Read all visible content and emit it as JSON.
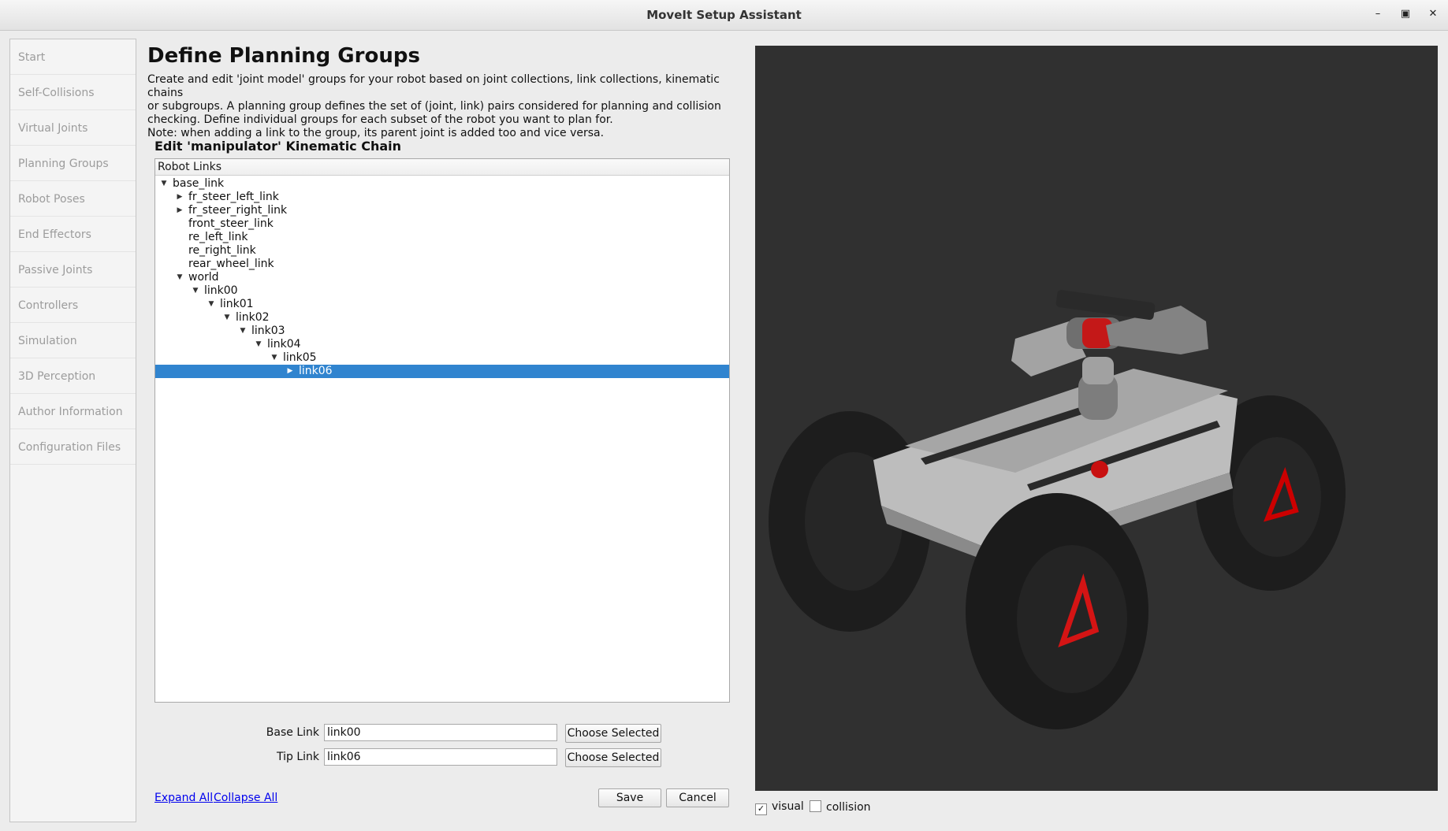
{
  "window": {
    "title": "MoveIt Setup Assistant"
  },
  "sidebar": {
    "items": [
      {
        "label": "Start"
      },
      {
        "label": "Self-Collisions"
      },
      {
        "label": "Virtual Joints"
      },
      {
        "label": "Planning Groups"
      },
      {
        "label": "Robot Poses"
      },
      {
        "label": "End Effectors"
      },
      {
        "label": "Passive Joints"
      },
      {
        "label": "Controllers"
      },
      {
        "label": "Simulation"
      },
      {
        "label": "3D Perception"
      },
      {
        "label": "Author Information"
      },
      {
        "label": "Configuration Files"
      }
    ]
  },
  "main": {
    "heading": "Define Planning Groups",
    "description_lines": [
      "Create and edit 'joint model' groups for your robot based on joint collections, link collections, kinematic chains",
      "or subgroups. A planning group defines the set of (joint, link) pairs considered for planning and collision",
      "checking. Define individual groups for each subset of the robot you want to plan for.",
      "Note: when adding a link to the group, its parent joint is added too and vice versa."
    ],
    "subheading": "Edit 'manipulator' Kinematic Chain",
    "tree": {
      "header": "Robot Links",
      "rows": [
        {
          "label": "base_link",
          "depth": 0,
          "expander": "expanded",
          "selected": false
        },
        {
          "label": "fr_steer_left_link",
          "depth": 1,
          "expander": "collapsed",
          "selected": false
        },
        {
          "label": "fr_steer_right_link",
          "depth": 1,
          "expander": "collapsed",
          "selected": false
        },
        {
          "label": "front_steer_link",
          "depth": 1,
          "expander": "none",
          "selected": false
        },
        {
          "label": "re_left_link",
          "depth": 1,
          "expander": "none",
          "selected": false
        },
        {
          "label": "re_right_link",
          "depth": 1,
          "expander": "none",
          "selected": false
        },
        {
          "label": "rear_wheel_link",
          "depth": 1,
          "expander": "none",
          "selected": false
        },
        {
          "label": "world",
          "depth": 1,
          "expander": "expanded",
          "selected": false
        },
        {
          "label": "link00",
          "depth": 2,
          "expander": "expanded",
          "selected": false
        },
        {
          "label": "link01",
          "depth": 3,
          "expander": "expanded",
          "selected": false
        },
        {
          "label": "link02",
          "depth": 4,
          "expander": "expanded",
          "selected": false
        },
        {
          "label": "link03",
          "depth": 5,
          "expander": "expanded",
          "selected": false
        },
        {
          "label": "link04",
          "depth": 6,
          "expander": "expanded",
          "selected": false
        },
        {
          "label": "link05",
          "depth": 7,
          "expander": "expanded",
          "selected": false
        },
        {
          "label": "link06",
          "depth": 8,
          "expander": "collapsed",
          "selected": true
        }
      ]
    },
    "base_link": {
      "label": "Base Link",
      "value": "link00",
      "button": "Choose Selected"
    },
    "tip_link": {
      "label": "Tip Link",
      "value": "link06",
      "button": "Choose Selected"
    },
    "expand_all": "Expand All",
    "collapse_all": "Collapse All",
    "save": "Save",
    "cancel": "Cancel"
  },
  "viewport": {
    "background": "#303030",
    "visual": {
      "label": "visual",
      "checked": true
    },
    "collision": {
      "label": "collision",
      "checked": false
    }
  },
  "icons": {
    "minimize": "minimize-icon",
    "maximize": "maximize-icon",
    "close": "close-icon",
    "tree_expanded": "triangle-down-icon",
    "tree_collapsed": "triangle-right-icon",
    "checkmark": "checkmark-icon"
  }
}
